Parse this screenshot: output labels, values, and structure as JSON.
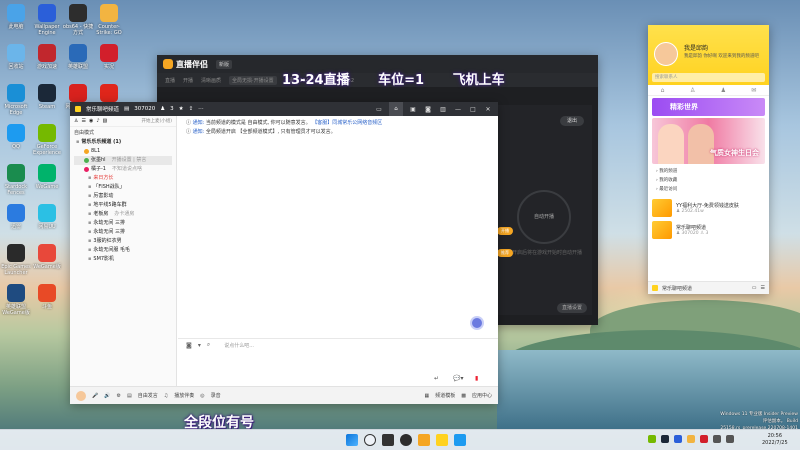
{
  "desktop": {
    "icons": [
      {
        "label": "此电脑",
        "color": "#4aa3e8"
      },
      {
        "label": "Wallpaper Engine",
        "color": "#2b5fd9"
      },
      {
        "label": "obs64 - 快捷方式",
        "color": "#2d2d2d"
      },
      {
        "label": "Counter-Strike: GO",
        "color": "#f2b441"
      },
      {
        "label": "回收站",
        "color": "#6bb5ea"
      },
      {
        "label": "游戏加速",
        "color": "#c1272d"
      },
      {
        "label": "英雄联盟",
        "color": "#2a6ab8"
      },
      {
        "label": "实况",
        "color": "#d21f2b"
      },
      {
        "label": "Microsoft Edge",
        "color": "#1a8fd6"
      },
      {
        "label": "Steam",
        "color": "#1b2838"
      },
      {
        "label": "网易云音乐",
        "color": "#d9221e"
      },
      {
        "label": "Adobe",
        "color": "#e0261b"
      },
      {
        "label": "QQ",
        "color": "#1d9bf0"
      },
      {
        "label": "GeForce Experience",
        "color": "#75b900"
      },
      {
        "label": "Stardock Fences",
        "color": "#1a8c4e"
      },
      {
        "label": "WeGame",
        "color": "#00b36b"
      },
      {
        "label": "迅雷",
        "color": "#2b7be0"
      },
      {
        "label": "网易UU",
        "color": "#2bc0e4"
      },
      {
        "label": "Epic Games Launcher",
        "color": "#2a2a2a"
      },
      {
        "label": "WeGame版",
        "color": "#e8483a"
      },
      {
        "label": "英雄联盟 WeGame版",
        "color": "#1f4b80"
      },
      {
        "label": "斗鱼",
        "color": "#e84a26"
      }
    ]
  },
  "live_window": {
    "app_name": "直播伴侣",
    "badge": "新版",
    "tabs": [
      "直播",
      "开播"
    ],
    "scene_label": "清晰画质",
    "source": "全局无损·开播设置",
    "stats": [
      "弹幕 1254953",
      "热度 39732"
    ],
    "exit_label": "退出",
    "start_label": "自动开播",
    "hint": "开启后将在游戏开始时自动开播",
    "pill_labels": [
      "开播",
      "推荐"
    ],
    "bottom_label": "直播设置"
  },
  "overlay": {
    "part1": "13-24直播",
    "part2": "车位=1",
    "part3": "飞机上车"
  },
  "chat_window": {
    "title": "常乐聊吧频道",
    "channel_id": "307020",
    "member_count": "3",
    "left_tools_link": "开始上麦(小组)",
    "tree": [
      {
        "text": "自由模式",
        "kind": "header"
      },
      {
        "text": "常乐乐乐频道 (1)",
        "kind": "group"
      },
      {
        "text": "8L1",
        "kind": "user"
      },
      {
        "text": "张墨hl",
        "kind": "user-selected",
        "extra": "开播设置 | 禁言"
      },
      {
        "text": "橘子-1",
        "kind": "user",
        "extra": "不知道说点啥"
      },
      {
        "text": "来日方长",
        "kind": "sub-red"
      },
      {
        "text": "「FISH战队」",
        "kind": "sub"
      },
      {
        "text": "厉害影动",
        "kind": "sub"
      },
      {
        "text": "地平线5路车群",
        "kind": "sub"
      },
      {
        "text": "老板房",
        "kind": "sub",
        "extra": "办卡通房"
      },
      {
        "text": "永劫无间 三排",
        "kind": "sub"
      },
      {
        "text": "永劫无间 三排",
        "kind": "sub"
      },
      {
        "text": "3服的红衣男",
        "kind": "sub"
      },
      {
        "text": "永劫无间服 毛毛",
        "kind": "sub"
      },
      {
        "text": "SM7影机",
        "kind": "sub"
      }
    ],
    "notices": [
      {
        "prefix": "通知:",
        "text": "当前频道的模式是 自由模式, 你可以随意发言。",
        "link": "【客服】同城常乐公网络音频区"
      },
      {
        "prefix": "通知:",
        "text": "全局频道开启 【全部频道模式】, 只有管理员才可以发言。",
        "link": ""
      }
    ],
    "input_placeholder": "说点什么吧...",
    "footer": {
      "voice_label": "自由发言",
      "music_label": "播放伴奏",
      "record_label": "录音",
      "settings_label": "频道模板",
      "app_center_label": "应用中心"
    }
  },
  "yy_panel": {
    "username": "我是邱韵",
    "signature": "我是邱韵 你好啊 欢迎来到我的频道吧",
    "search_placeholder": "搜索联系人",
    "banner1": "精彩世界",
    "banner2": "气质女神生日会",
    "menu": [
      "我的频道",
      "我的收藏",
      "最近访问"
    ],
    "rooms": [
      {
        "title": "YY福利大厅-免费领钱送皮肤",
        "meta": "2502.41w"
      },
      {
        "title": "常乐聊吧频道",
        "meta": "307020",
        "count": "3"
      }
    ],
    "bottom_label": "常乐聊吧频道"
  },
  "caption": "全段位有号",
  "watermark": {
    "line1": "Windows 11 专业版 Insider Preview",
    "line2": "评估副本。 Build 25158.rs_prerelease.220708-1401"
  },
  "taskbar": {
    "time": "20:56",
    "date": "2022/7/25"
  },
  "colors": {
    "accent_yellow": "#ffd21f",
    "brand_orange": "#f5a623",
    "overlay_purple": "#3b1e7a",
    "selected_grey": "#e8e8e8"
  }
}
